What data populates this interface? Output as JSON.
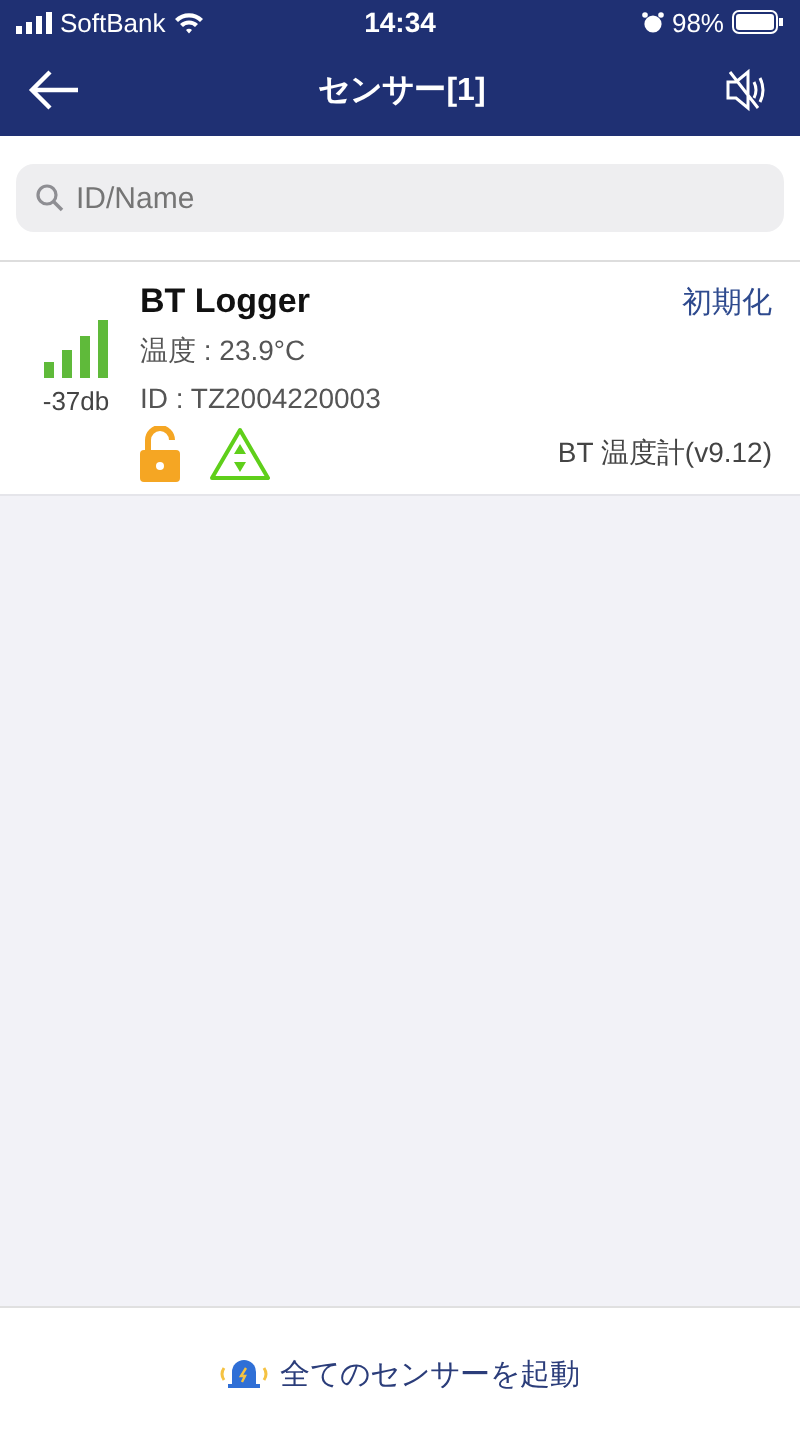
{
  "status_bar": {
    "carrier": "SoftBank",
    "time": "14:34",
    "battery": "98%"
  },
  "header": {
    "title": "センサー[1]"
  },
  "search": {
    "placeholder": "ID/Name"
  },
  "sensors": [
    {
      "name": "BT Logger",
      "action": "初期化",
      "temperature": "温度 : 23.9°C",
      "id": "ID : TZ2004220003",
      "rssi": "-37db",
      "model": "BT 温度計(v9.12)",
      "locked": false
    }
  ],
  "footer": {
    "label": "全てのセンサーを起動"
  }
}
